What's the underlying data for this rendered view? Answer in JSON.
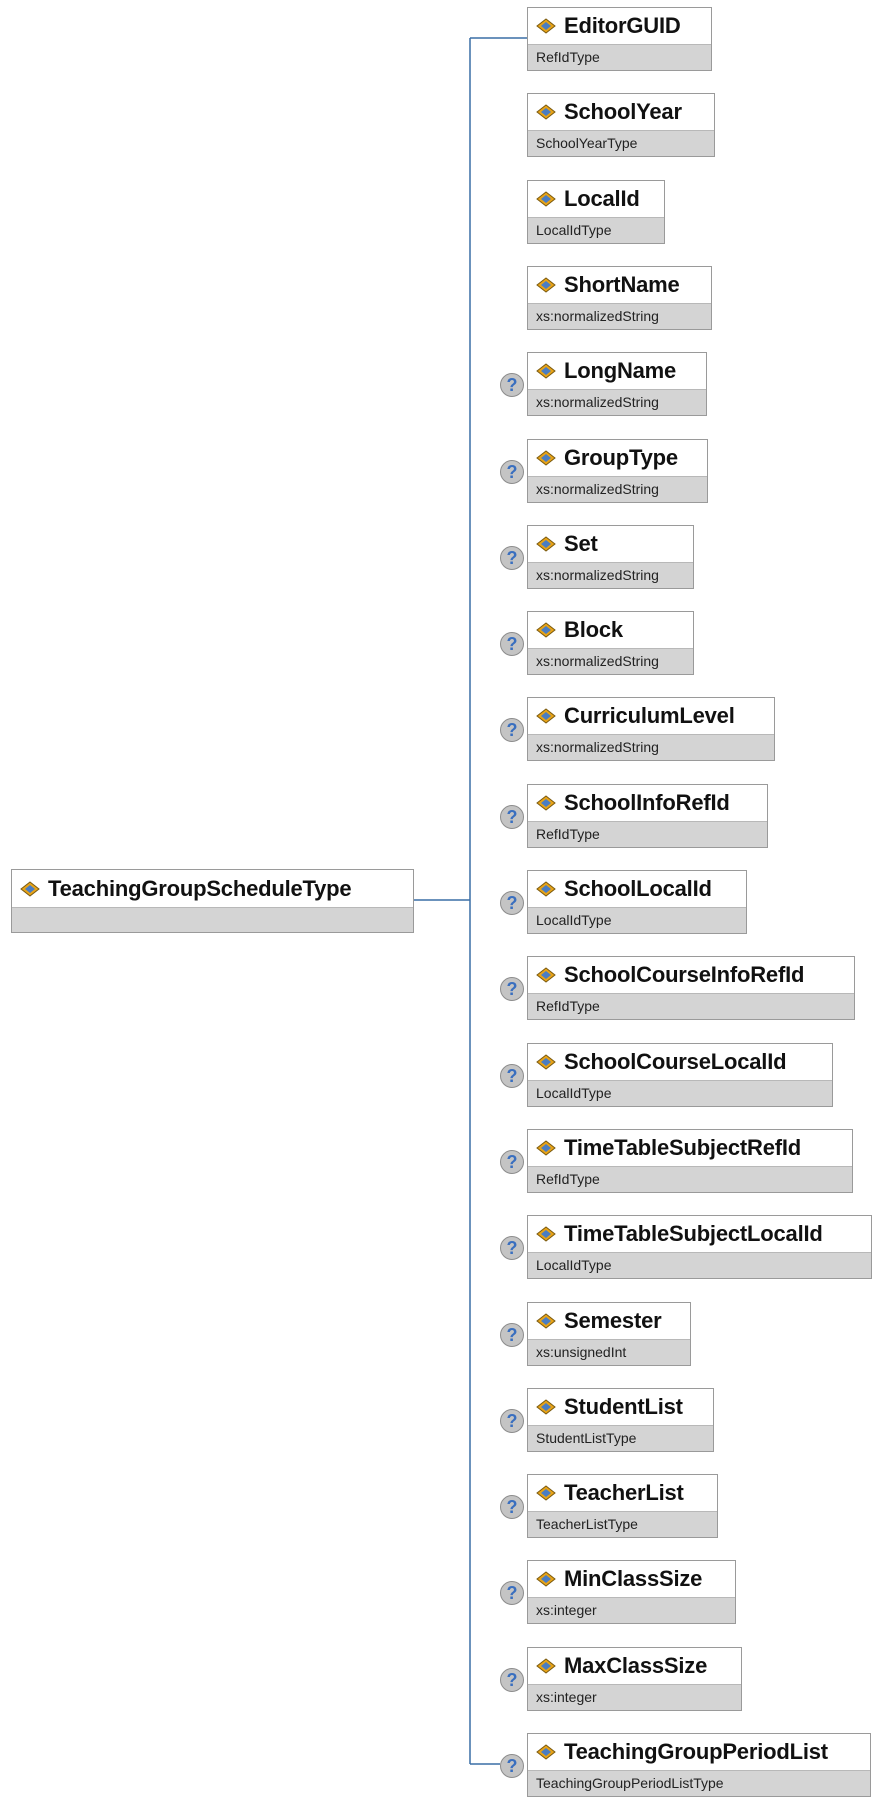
{
  "root": {
    "name": "TeachingGroupScheduleType",
    "type": ""
  },
  "children": [
    {
      "name": "EditorGUID",
      "type": "RefIdType",
      "optional": false
    },
    {
      "name": "SchoolYear",
      "type": "SchoolYearType",
      "optional": false
    },
    {
      "name": "LocalId",
      "type": "LocalIdType",
      "optional": false
    },
    {
      "name": "ShortName",
      "type": "xs:normalizedString",
      "optional": false
    },
    {
      "name": "LongName",
      "type": "xs:normalizedString",
      "optional": true
    },
    {
      "name": "GroupType",
      "type": "xs:normalizedString",
      "optional": true
    },
    {
      "name": "Set",
      "type": "xs:normalizedString",
      "optional": true
    },
    {
      "name": "Block",
      "type": "xs:normalizedString",
      "optional": true
    },
    {
      "name": "CurriculumLevel",
      "type": "xs:normalizedString",
      "optional": true
    },
    {
      "name": "SchoolInfoRefId",
      "type": "RefIdType",
      "optional": true
    },
    {
      "name": "SchoolLocalId",
      "type": "LocalIdType",
      "optional": true
    },
    {
      "name": "SchoolCourseInfoRefId",
      "type": "RefIdType",
      "optional": true
    },
    {
      "name": "SchoolCourseLocalId",
      "type": "LocalIdType",
      "optional": true
    },
    {
      "name": "TimeTableSubjectRefId",
      "type": "RefIdType",
      "optional": true
    },
    {
      "name": "TimeTableSubjectLocalId",
      "type": "LocalIdType",
      "optional": true
    },
    {
      "name": "Semester",
      "type": "xs:unsignedInt",
      "optional": true
    },
    {
      "name": "StudentList",
      "type": "StudentListType",
      "optional": true
    },
    {
      "name": "TeacherList",
      "type": "TeacherListType",
      "optional": true
    },
    {
      "name": "MinClassSize",
      "type": "xs:integer",
      "optional": true
    },
    {
      "name": "MaxClassSize",
      "type": "xs:integer",
      "optional": true
    },
    {
      "name": "TeachingGroupPeriodList",
      "type": "TeachingGroupPeriodListType",
      "optional": true
    }
  ],
  "optional_marker": "?",
  "colors": {
    "connector": "#3a6ea5",
    "node_fill": "#d4d4d4",
    "node_header": "#ffffff",
    "badge_text": "#3a6fbf"
  },
  "icons": {
    "element": "element-diamond-icon",
    "optional": "optional-question-icon"
  }
}
